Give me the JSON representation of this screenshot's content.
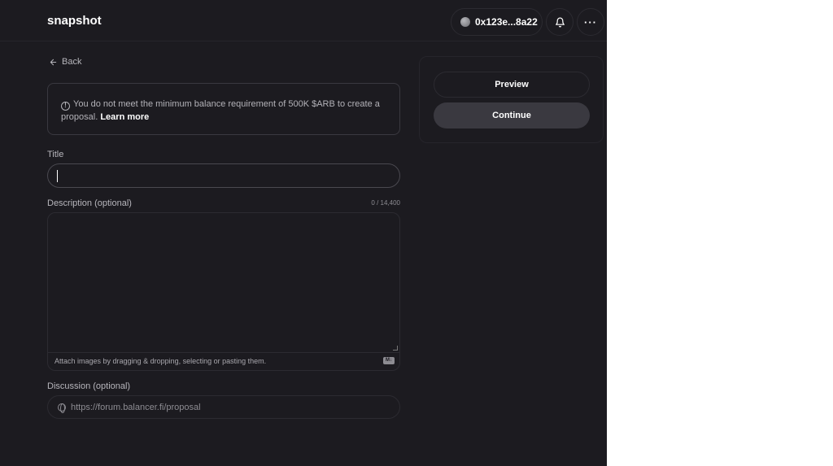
{
  "header": {
    "brand": "snapshot",
    "account": "0x123e...8a22",
    "bell_icon": "bell-icon",
    "more_label": "···"
  },
  "back_label": "Back",
  "alert": {
    "message": "You do not meet the minimum balance requirement of 500K $ARB to create a proposal.",
    "link": "Learn more"
  },
  "form": {
    "title_label": "Title",
    "title_value": "",
    "description_label": "Description (optional)",
    "description_counter": "0 / 14,400",
    "description_value": "",
    "attach_hint": "Attach images by dragging & dropping, selecting or pasting them.",
    "discussion_label": "Discussion (optional)",
    "discussion_placeholder": "https://forum.balancer.fi/proposal"
  },
  "actions": {
    "preview": "Preview",
    "continue": "Continue"
  },
  "colors": {
    "background": "#1c1b20",
    "button_secondary": "#3a3940"
  }
}
